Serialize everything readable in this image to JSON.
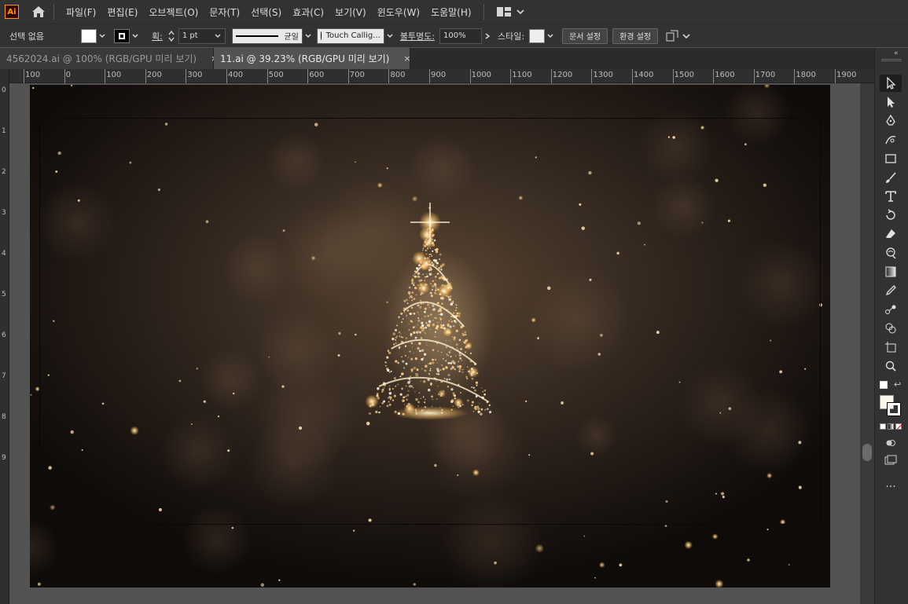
{
  "menubar": {
    "logo": "Ai",
    "items": [
      "파일(F)",
      "편집(E)",
      "오브젝트(O)",
      "문자(T)",
      "선택(S)",
      "효과(C)",
      "보기(V)",
      "윈도우(W)",
      "도움말(H)"
    ]
  },
  "control": {
    "selection_label": "선택 없음",
    "fill_color": "#ffffff",
    "stroke_label": "획:",
    "stroke_weight": "1 pt",
    "stroke_profile": "균일",
    "brush": "Touch Callig...",
    "opacity_label": "불투명도:",
    "opacity_value": "100%",
    "style_label": "스타일:",
    "doc_setup_button": "문서 설정",
    "prefs_button": "환경 설정"
  },
  "tabs": [
    {
      "label": "4562024.ai @ 100% (RGB/GPU 미리 보기)",
      "close": "×",
      "active": false
    },
    {
      "label": "11.ai @ 39.23% (RGB/GPU 미리 보기)",
      "close": "×",
      "active": true
    }
  ],
  "ruler": {
    "top_ticks": [
      "100",
      "0",
      "100",
      "200",
      "300",
      "400",
      "500",
      "600",
      "700",
      "800",
      "900",
      "1000",
      "1100",
      "1200",
      "1300",
      "1400",
      "1500",
      "1600",
      "1700",
      "1800",
      "1900"
    ],
    "left_ticks": [
      "0",
      "1",
      "2",
      "3",
      "4",
      "5",
      "6",
      "7",
      "8",
      "9"
    ]
  },
  "colors": {
    "accent": "#ff9a00",
    "ui_dark": "#323232",
    "canvas_bg": "#535353"
  },
  "tools": [
    {
      "name": "selection-tool"
    },
    {
      "name": "direct-selection-tool"
    },
    {
      "name": "pen-tool"
    },
    {
      "name": "curvature-tool"
    },
    {
      "name": "rectangle-tool"
    },
    {
      "name": "paintbrush-tool"
    },
    {
      "name": "type-tool"
    },
    {
      "name": "rotate-tool"
    },
    {
      "name": "eraser-tool"
    },
    {
      "name": "warp-tool"
    },
    {
      "name": "gradient-tool"
    },
    {
      "name": "eyedropper-tool"
    },
    {
      "name": "blend-tool"
    },
    {
      "name": "shape-builder-tool"
    },
    {
      "name": "artboard-tool"
    },
    {
      "name": "zoom-tool"
    }
  ]
}
